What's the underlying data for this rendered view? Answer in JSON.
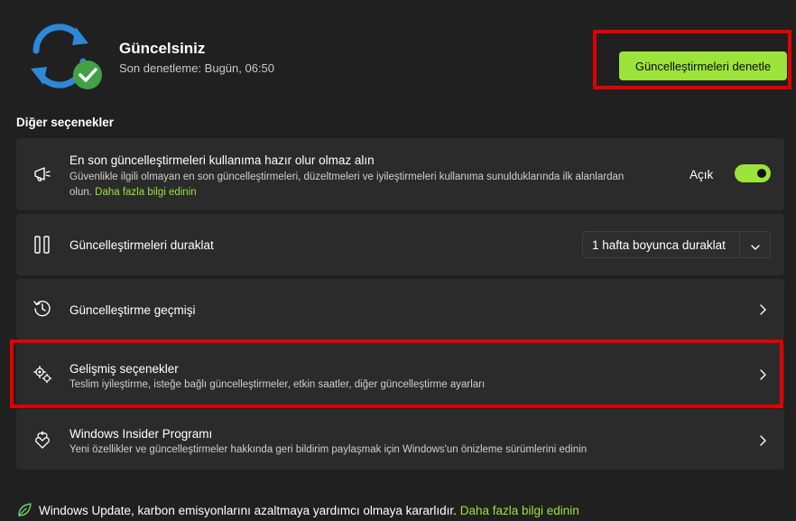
{
  "header": {
    "status_title": "Güncelsiniz",
    "last_checked": "Son denetleme: Bugün, 06:50",
    "check_button": "Güncelleştirmeleri denetle"
  },
  "section_title": "Diğer seçenekler",
  "cards": {
    "latest_updates": {
      "title": "En son güncelleştirmeleri kullanıma hazır olur olmaz alın",
      "desc_line1": "Güvenlikle ilgili olmayan en son güncelleştirmeleri, düzeltmeleri ve iyileştirmeleri kullanıma sunulduklarında ilk alanlardan",
      "desc_line2_prefix": "olun. ",
      "desc_link": "Daha fazla bilgi edinin",
      "toggle_label": "Açık",
      "toggle_on": true
    },
    "pause": {
      "title": "Güncelleştirmeleri duraklat",
      "dropdown_value": "1 hafta boyunca duraklat"
    },
    "history": {
      "title": "Güncelleştirme geçmişi"
    },
    "advanced": {
      "title": "Gelişmiş seçenekler",
      "desc": "Teslim iyileştirme, isteğe bağlı güncelleştirmeler, etkin saatler, diğer güncelleştirme ayarları"
    },
    "insider": {
      "title": "Windows Insider Programı",
      "desc": "Yeni özellikler ve güncelleştirmeler hakkında geri bildirim paylaşmak için Windows'un önizleme sürümlerini edinin"
    }
  },
  "footer": {
    "text": "Windows Update, karbon emisyonlarını azaltmaya yardımcı olmaya kararlıdır.",
    "link": "Daha fazla bilgi edinin"
  },
  "colors": {
    "accent": "#9ce33b",
    "background": "#202020",
    "card": "#2b2b2b",
    "highlight_box": "#e00000"
  },
  "icons": {
    "header": "sync-check-icon",
    "latest": "megaphone-icon",
    "pause": "pause-icon",
    "history": "history-icon",
    "advanced": "gears-icon",
    "insider": "insider-hearts-icon",
    "footer": "leaf-icon"
  }
}
